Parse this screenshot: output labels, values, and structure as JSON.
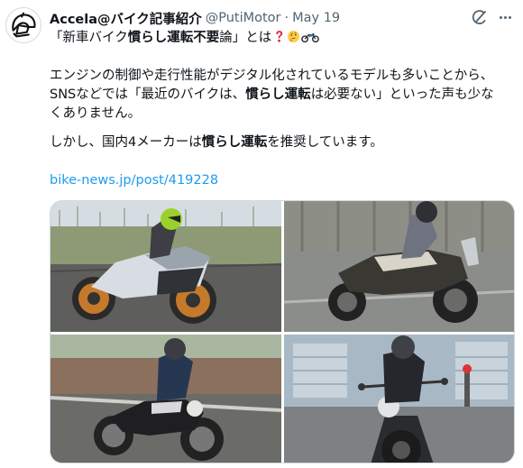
{
  "tweet": {
    "author_name": "Accela@バイク記事紹介",
    "handle": "@PutiMotor",
    "separator": "·",
    "date": "May 19",
    "line1_pre": "「新車バイク",
    "line1_bold": "慣らし運転不要",
    "line1_post": "論」とは",
    "para1_line1": "エンジンの制御や走行性能がデジタル化されているモデルも多いことから、",
    "para1_line2_pre": "SNSなどでは「最近のバイクは、",
    "para1_line2_bold": "慣らし運転",
    "para1_line2_post": "は必要ない」といった声も少な",
    "para1_line3": "くありません。",
    "para2_pre": "しかし、国内4メーカーは",
    "para2_bold": "慣らし運転",
    "para2_post": "を推奨しています。",
    "link": "bike-news.jp/post/419228"
  },
  "icons": {
    "avatar": "motorcycle-helmet-logo-icon",
    "grok": "grok-icon",
    "more": "more-dots-icon",
    "emoji1": "red-question-mark-icon",
    "emoji2": "thinking-face-icon",
    "emoji3": "motorcycle-icon"
  },
  "colors": {
    "link": "#1d9bf0",
    "secondary_text": "#536471"
  }
}
